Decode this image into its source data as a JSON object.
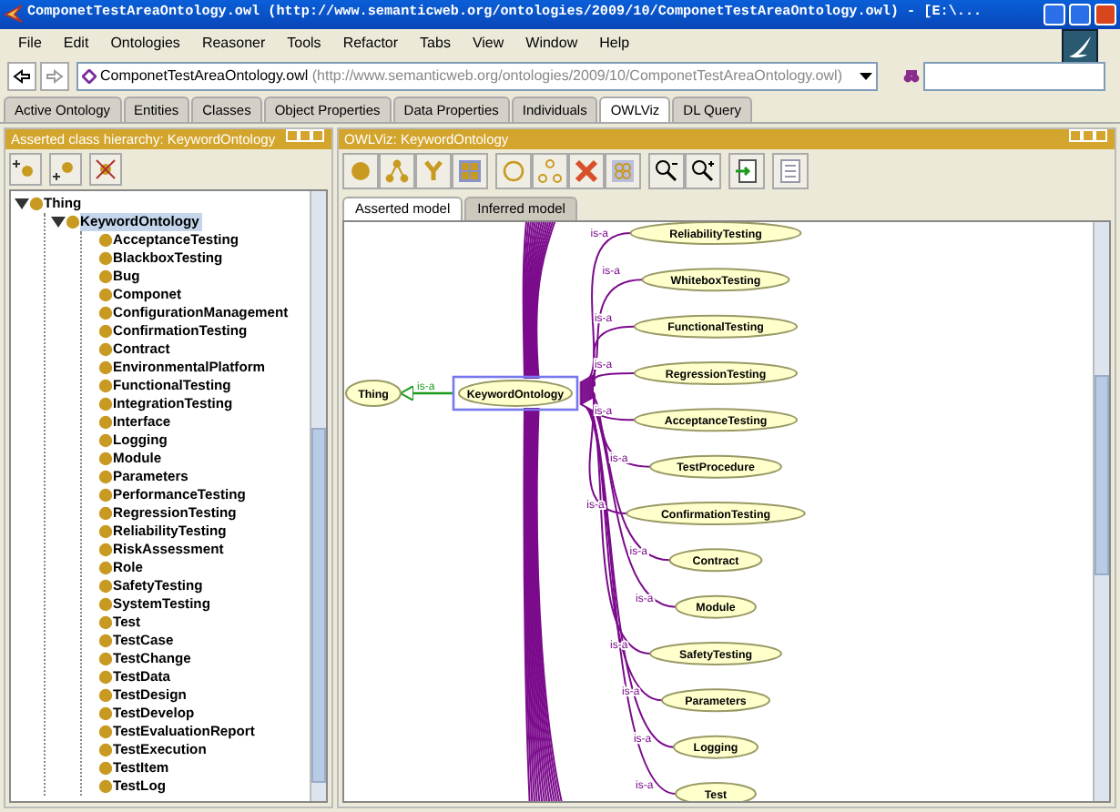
{
  "window": {
    "title": "ComponetTestAreaOntology.owl (http://www.semanticweb.org/ontologies/2009/10/ComponetTestAreaOntology.owl) - [E:\\..."
  },
  "menu": [
    "File",
    "Edit",
    "Ontologies",
    "Reasoner",
    "Tools",
    "Refactor",
    "Tabs",
    "View",
    "Window",
    "Help"
  ],
  "address": {
    "name": "ComponetTestAreaOntology.owl",
    "url": "(http://www.semanticweb.org/ontologies/2009/10/ComponetTestAreaOntology.owl)"
  },
  "tabs": [
    {
      "label": "Active Ontology",
      "selected": false
    },
    {
      "label": "Entities",
      "selected": false
    },
    {
      "label": "Classes",
      "selected": false
    },
    {
      "label": "Object Properties",
      "selected": false
    },
    {
      "label": "Data Properties",
      "selected": false
    },
    {
      "label": "Individuals",
      "selected": false
    },
    {
      "label": "OWLViz",
      "selected": true
    },
    {
      "label": "DL Query",
      "selected": false
    }
  ],
  "class_hierarchy": {
    "title": "Asserted class hierarchy: KeywordOntology",
    "tree": [
      {
        "label": "Thing",
        "selected": false,
        "expanded": true,
        "children": [
          {
            "label": "KeywordOntology",
            "selected": true,
            "expanded": true,
            "children": [
              {
                "label": "AcceptanceTesting",
                "selected": false
              },
              {
                "label": "BlackboxTesting",
                "selected": false
              },
              {
                "label": "Bug",
                "selected": false
              },
              {
                "label": "Componet",
                "selected": false
              },
              {
                "label": "ConfigurationManagement",
                "selected": false
              },
              {
                "label": "ConfirmationTesting",
                "selected": false
              },
              {
                "label": "Contract",
                "selected": false
              },
              {
                "label": "EnvironmentalPlatform",
                "selected": false
              },
              {
                "label": "FunctionalTesting",
                "selected": false
              },
              {
                "label": "IntegrationTesting",
                "selected": false
              },
              {
                "label": "Interface",
                "selected": false
              },
              {
                "label": "Logging",
                "selected": false
              },
              {
                "label": "Module",
                "selected": false
              },
              {
                "label": "Parameters",
                "selected": false
              },
              {
                "label": "PerformanceTesting",
                "selected": false
              },
              {
                "label": "RegressionTesting",
                "selected": false
              },
              {
                "label": "ReliabilityTesting",
                "selected": false
              },
              {
                "label": "RiskAssessment",
                "selected": false
              },
              {
                "label": "Role",
                "selected": false
              },
              {
                "label": "SafetyTesting",
                "selected": false
              },
              {
                "label": "SystemTesting",
                "selected": false
              },
              {
                "label": "Test",
                "selected": false
              },
              {
                "label": "TestCase",
                "selected": false
              },
              {
                "label": "TestChange",
                "selected": false
              },
              {
                "label": "TestData",
                "selected": false
              },
              {
                "label": "TestDesign",
                "selected": false
              },
              {
                "label": "TestDevelop",
                "selected": false
              },
              {
                "label": "TestEvaluationReport",
                "selected": false
              },
              {
                "label": "TestExecution",
                "selected": false
              },
              {
                "label": "TestItem",
                "selected": false
              },
              {
                "label": "TestLog",
                "selected": false
              }
            ]
          }
        ]
      }
    ]
  },
  "owlviz": {
    "title": "OWLViz: KeywordOntology",
    "view_tabs": [
      {
        "label": "Asserted model",
        "selected": true
      },
      {
        "label": "Inferred model",
        "selected": false
      }
    ],
    "graph": {
      "root": {
        "label": "Thing",
        "edge_label": "is-a"
      },
      "focus": {
        "label": "KeywordOntology",
        "selected": true
      },
      "subclasses": [
        {
          "label": "ReliabilityTesting",
          "edge_label": "is-a"
        },
        {
          "label": "WhiteboxTesting",
          "edge_label": "is-a"
        },
        {
          "label": "FunctionalTesting",
          "edge_label": "is-a"
        },
        {
          "label": "RegressionTesting",
          "edge_label": "is-a"
        },
        {
          "label": "AcceptanceTesting",
          "edge_label": "is-a"
        },
        {
          "label": "TestProcedure",
          "edge_label": "is-a"
        },
        {
          "label": "ConfirmationTesting",
          "edge_label": "is-a"
        },
        {
          "label": "Contract",
          "edge_label": "is-a"
        },
        {
          "label": "Module",
          "edge_label": "is-a"
        },
        {
          "label": "SafetyTesting",
          "edge_label": "is-a"
        },
        {
          "label": "Parameters",
          "edge_label": "is-a"
        },
        {
          "label": "Logging",
          "edge_label": "is-a"
        },
        {
          "label": "Test",
          "edge_label": "is-a"
        }
      ]
    }
  }
}
